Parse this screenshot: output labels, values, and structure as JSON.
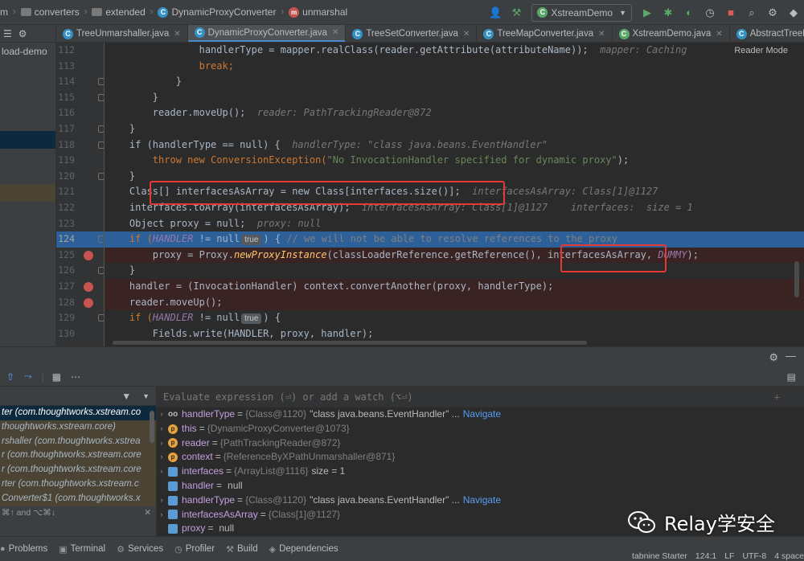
{
  "breadcrumb": [
    "m",
    "converters",
    "extended",
    "DynamicProxyConverter",
    "unmarshal"
  ],
  "run_config": "XstreamDemo",
  "left_panel": {
    "label": "load-demo"
  },
  "tabs": [
    {
      "label": "TreeUnmarshaller.java",
      "active": false
    },
    {
      "label": "DynamicProxyConverter.java",
      "active": true
    },
    {
      "label": "TreeSetConverter.java",
      "active": false
    },
    {
      "label": "TreeMapConverter.java",
      "active": false
    },
    {
      "label": "XstreamDemo.java",
      "active": false
    },
    {
      "label": "AbstractTreeMarsha",
      "active": false
    }
  ],
  "reader_mode": "Reader Mode",
  "line_numbers": [
    "112",
    "113",
    "114",
    "115",
    "116",
    "117",
    "118",
    "119",
    "120",
    "121",
    "122",
    "123",
    "124",
    "125",
    "126",
    "127",
    "128",
    "129",
    "130"
  ],
  "code": {
    "l112_code": "                handlerType = mapper.realClass(reader.getAttribute(attributeName));",
    "l112_hint": "  mapper: Caching",
    "l113": "                break;",
    "l114": "            }",
    "l115": "        }",
    "l116_code": "        reader.moveUp();",
    "l116_hint": "  reader: PathTrackingReader@872",
    "l117": "    }",
    "l118_code": "    if (handlerType == null) {",
    "l118_hint": "  handlerType: \"class java.beans.EventHandler\"",
    "l119_a": "        throw new ConversionException(",
    "l119_s": "\"No InvocationHandler specified for dynamic proxy\"",
    "l119_b": ");",
    "l120": "    }",
    "l121_code": "    Class[] interfacesAsArray = new Class[interfaces.size()];",
    "l121_hint": "  interfacesAsArray: Class[1]@1127",
    "l122_code": "    interfaces.toArray(interfacesAsArray);",
    "l122_hint": "  interfacesAsArray: Class[1]@1127    interfaces:  size = 1",
    "l123_code": "    Object proxy = null;",
    "l123_hint": "  proxy: null",
    "l124_a": "    if (",
    "l124_f": "HANDLER",
    "l124_b": " != null",
    "l124_badge": "true",
    "l124_c": ") { ",
    "l124_cm": "// we will not be able to resolve references to the proxy",
    "l125_a": "        proxy = Proxy.",
    "l125_m": "newProxyInstance",
    "l125_b": "(classLoaderReference.getReference(), interfacesAsArray, ",
    "l125_f": "DUMMY",
    "l125_c": ");",
    "l126": "    }",
    "l127": "    handler = (InvocationHandler) context.convertAnother(proxy, handlerType);",
    "l128": "    reader.moveUp();",
    "l129_a": "    if (",
    "l129_f": "HANDLER",
    "l129_b": " != null",
    "l129_badge": "true",
    "l129_c": ") {",
    "l130": "        Fields.write(HANDLER, proxy, handler);"
  },
  "debug": {
    "evaluate_placeholder": "Evaluate expression (⏎) or add a watch (⌥⏎)",
    "frames": [
      {
        "label": "ter (com.thoughtworks.xstream.co",
        "kind": "sel"
      },
      {
        "label": "thoughtworks.xstream.core)",
        "kind": "lib"
      },
      {
        "label": "rshaller (com.thoughtworks.xstrea",
        "kind": "lib"
      },
      {
        "label": "r (com.thoughtworks.xstream.core",
        "kind": "lib"
      },
      {
        "label": "r (com.thoughtworks.xstream.core",
        "kind": "lib"
      },
      {
        "label": "rter (com.thoughtworks.xstream.c",
        "kind": "lib"
      },
      {
        "label": "Converter$1 (com.thoughtworks.x",
        "kind": "lib"
      }
    ],
    "frames_hint": "⌘↑ and ⌥⌘↓",
    "variables": [
      {
        "icon": "oo",
        "kind": "w",
        "arrow": "›",
        "name": "handlerType",
        "ref": "{Class@1120}",
        "value": "\"class java.beans.EventHandler\" ...",
        "nav": "Navigate"
      },
      {
        "icon": "p",
        "kind": "p",
        "arrow": "›",
        "name": "this",
        "ref": "{DynamicProxyConverter@1073}",
        "value": "",
        "nav": ""
      },
      {
        "icon": "p",
        "kind": "p",
        "arrow": "›",
        "name": "reader",
        "ref": "{PathTrackingReader@872}",
        "value": "",
        "nav": ""
      },
      {
        "icon": "p",
        "kind": "p",
        "arrow": "›",
        "name": "context",
        "ref": "{ReferenceByXPathUnmarshaller@871}",
        "value": "",
        "nav": ""
      },
      {
        "icon": "",
        "kind": "l",
        "arrow": "›",
        "name": "interfaces",
        "ref": "{ArrayList@1116}",
        "value": " size = 1",
        "nav": ""
      },
      {
        "icon": "",
        "kind": "l",
        "arrow": "",
        "name": "handler",
        "ref": "",
        "value": "null",
        "nav": ""
      },
      {
        "icon": "",
        "kind": "l",
        "arrow": "›",
        "name": "handlerType",
        "ref": "{Class@1120}",
        "value": "\"class java.beans.EventHandler\" ...",
        "nav": "Navigate"
      },
      {
        "icon": "",
        "kind": "l",
        "arrow": "›",
        "name": "interfacesAsArray",
        "ref": "{Class[1]@1127}",
        "value": "",
        "nav": ""
      },
      {
        "icon": "",
        "kind": "l",
        "arrow": "",
        "name": "proxy",
        "ref": "",
        "value": "null",
        "nav": ""
      }
    ]
  },
  "statusbar": [
    {
      "icon": "bug-icon",
      "label": "Problems"
    },
    {
      "icon": "terminal-icon",
      "label": "Terminal"
    },
    {
      "icon": "services-icon",
      "label": "Services"
    },
    {
      "icon": "profiler-icon",
      "label": "Profiler"
    },
    {
      "icon": "build-icon",
      "label": "Build"
    },
    {
      "icon": "dependencies-icon",
      "label": "Dependencies"
    }
  ],
  "status_right": {
    "plugin": "tabnine Starter",
    "position": "124:1",
    "line_sep": "LF",
    "encoding": "UTF-8",
    "indent": "4 space"
  },
  "watermark": {
    "text": "Relay学安全"
  },
  "colors": {
    "current_line": "#2d6099",
    "breakpoint": "#c75450",
    "annotation_box": "#e53935"
  }
}
